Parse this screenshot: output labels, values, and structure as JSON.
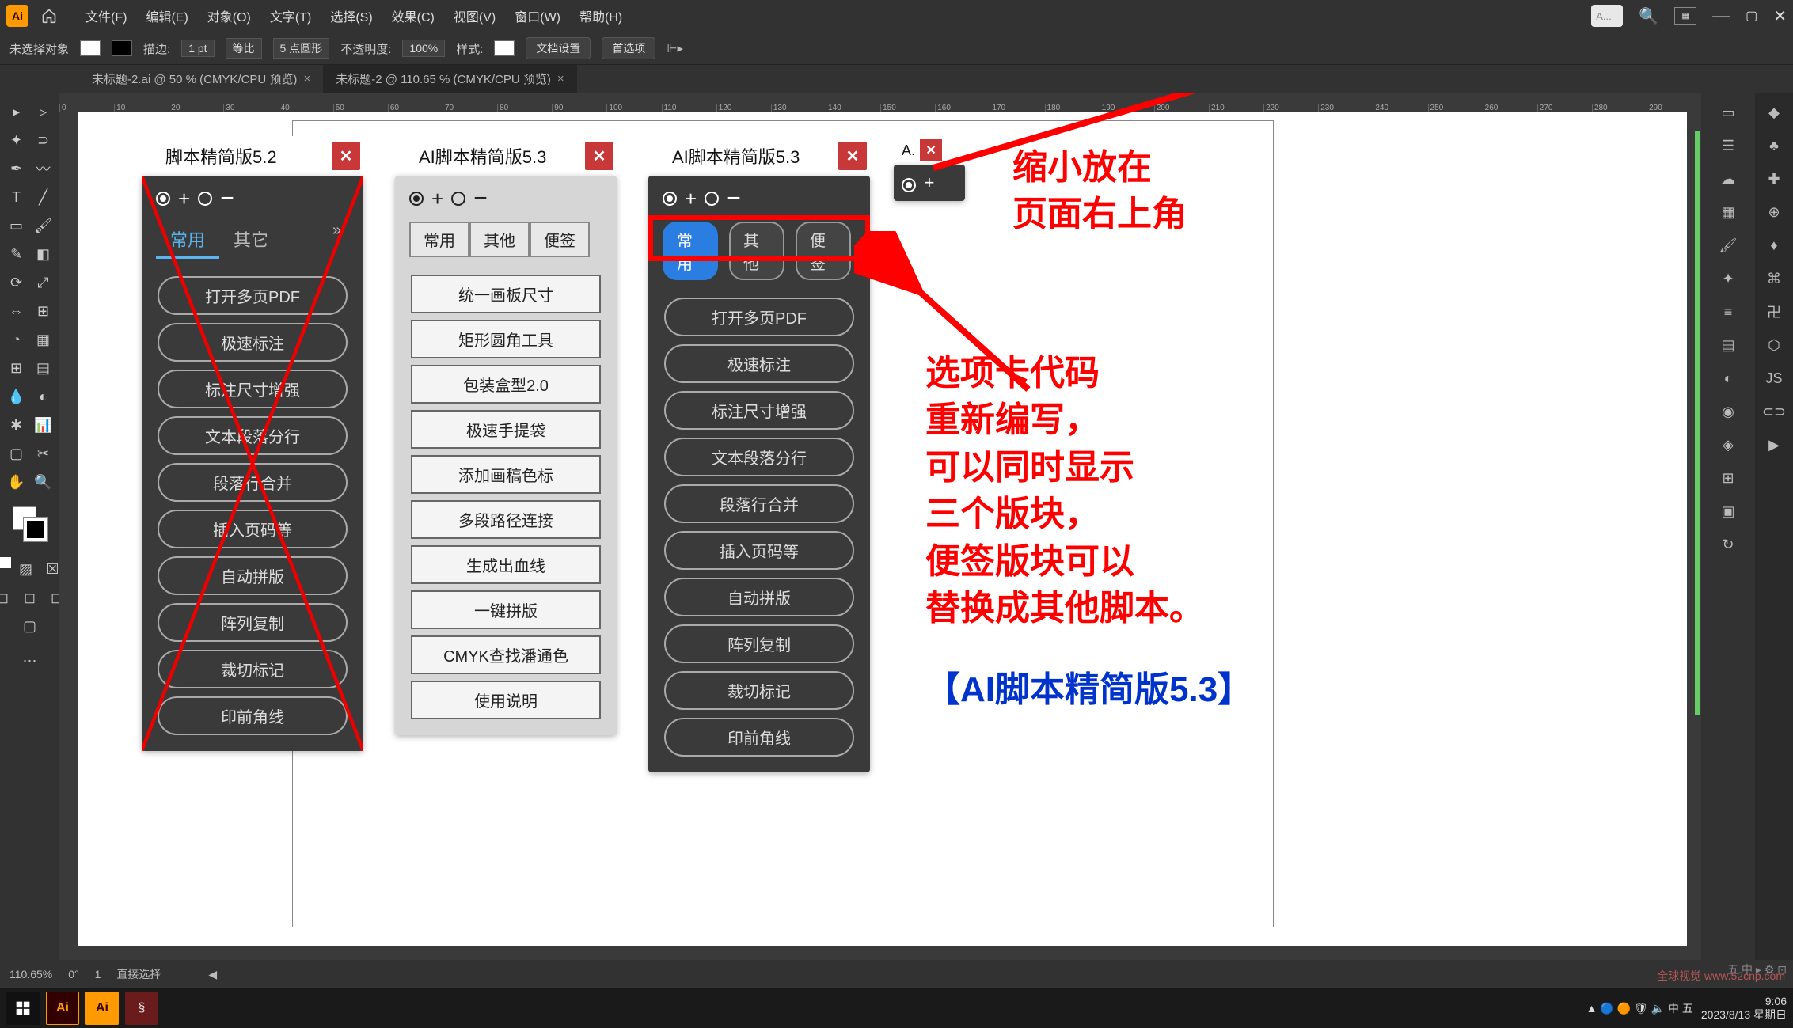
{
  "menubar": {
    "logo": "Ai",
    "items": [
      "文件(F)",
      "编辑(E)",
      "对象(O)",
      "文字(T)",
      "选择(S)",
      "效果(C)",
      "视图(V)",
      "窗口(W)",
      "帮助(H)"
    ],
    "search_placeholder": "A..."
  },
  "controlbar": {
    "no_selection": "未选择对象",
    "stroke_label": "描边:",
    "stroke_value": "1 pt",
    "uniform": "等比",
    "brush_label": "5 点圆形",
    "opacity_label": "不透明度:",
    "opacity_value": "100%",
    "style_label": "样式:",
    "doc_setup": "文档设置",
    "prefs": "首选项"
  },
  "tabs": [
    {
      "label": "未标题-2.ai @ 50 % (CMYK/CPU 预览)",
      "close": "×"
    },
    {
      "label": "未标题-2 @ 110.65 % (CMYK/CPU 预览)",
      "close": "×"
    }
  ],
  "ruler_ticks": [
    "0",
    "10",
    "20",
    "30",
    "40",
    "50",
    "60",
    "70",
    "80",
    "90",
    "100",
    "110",
    "120",
    "130",
    "140",
    "150",
    "160",
    "170",
    "180",
    "190",
    "200",
    "210",
    "220",
    "230",
    "240",
    "250",
    "260",
    "270",
    "280",
    "290"
  ],
  "panel52": {
    "title": "脚本精简版5.2",
    "tabs": [
      "常用",
      "其它"
    ],
    "buttons": [
      "打开多页PDF",
      "极速标注",
      "标注尺寸增强",
      "文本段落分行",
      "段落行合并",
      "插入页码等",
      "自动拼版",
      "阵列复制",
      "裁切标记",
      "印前角线"
    ]
  },
  "panel53light": {
    "title": "AI脚本精简版5.3",
    "tabs": [
      "常用",
      "其他",
      "便签"
    ],
    "buttons": [
      "统一画板尺寸",
      "矩形圆角工具",
      "包装盒型2.0",
      "极速手提袋",
      "添加画稿色标",
      "多段路径连接",
      "生成出血线",
      "一键拼版",
      "CMYK查找潘通色",
      "使用说明"
    ]
  },
  "panel53dark": {
    "title": "AI脚本精简版5.3",
    "tabs": [
      "常用",
      "其他",
      "便签"
    ],
    "buttons": [
      "打开多页PDF",
      "极速标注",
      "标注尺寸增强",
      "文本段落分行",
      "段落行合并",
      "插入页码等",
      "自动拼版",
      "阵列复制",
      "裁切标记",
      "印前角线"
    ]
  },
  "mini_panel": {
    "title": "A."
  },
  "annotations": {
    "top": "缩小放在\n页面右上角",
    "mid": "选项卡代码\n重新编写，\n可以同时显示\n三个版块，\n便签版块可以\n替换成其他脚本。",
    "bottom": "【AI脚本精简版5.3】"
  },
  "statusbar": {
    "zoom": "110.65%",
    "rotate": "0°",
    "artboard": "1",
    "tool": "直接选择"
  },
  "systray": {
    "ime_top": "五 中 ▸ ⚙ ⊡",
    "icons": "▲ 🔵 🟠 🛡 🔈 中 五",
    "time": "9:06",
    "date": "2023/8/13 星期日"
  },
  "watermark": "全球视觉 www.52cnp.com"
}
